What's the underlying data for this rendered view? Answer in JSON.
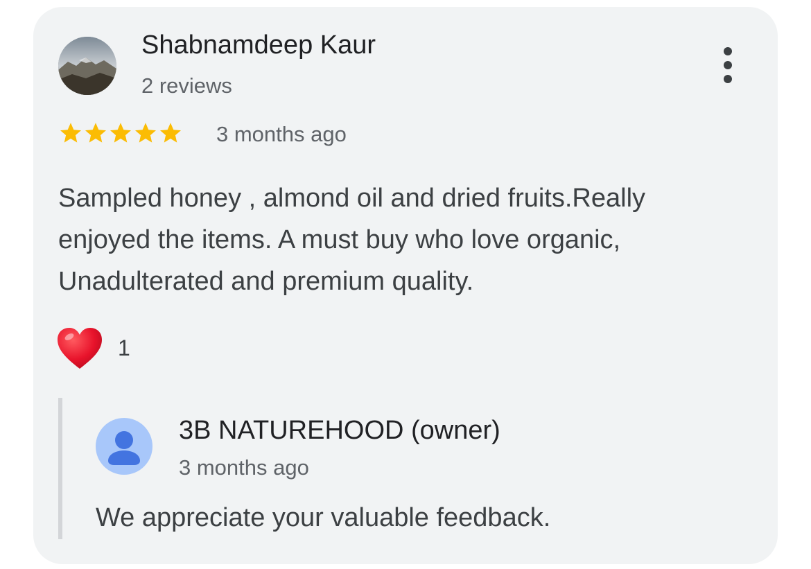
{
  "review": {
    "reviewer_name": "Shabnamdeep Kaur",
    "review_count": "2 reviews",
    "rating": 5,
    "rating_max": 5,
    "time": "3 months ago",
    "text_lines": [
      "Sampled honey , almond oil and dried fruits.Really",
      "enjoyed the items. A must buy who love organic,",
      "Unadulterated and premium quality."
    ],
    "reaction": {
      "icon": "heart-icon",
      "count": "1"
    }
  },
  "owner_reply": {
    "name": "3B NATUREHOOD (owner)",
    "time": "3 months ago",
    "text": "We appreciate your valuable feedback."
  },
  "icons": {
    "more": "more-vert-icon",
    "star": "star-icon",
    "owner_avatar": "person-icon"
  },
  "colors": {
    "card_background": "#f1f3f4",
    "star": "#fbbc04",
    "heart": "#e8132b",
    "owner_avatar_bg": "#a8c7fa",
    "owner_avatar_fg": "#4374e0",
    "secondary_text": "#5f6368",
    "primary_text": "#202124"
  }
}
